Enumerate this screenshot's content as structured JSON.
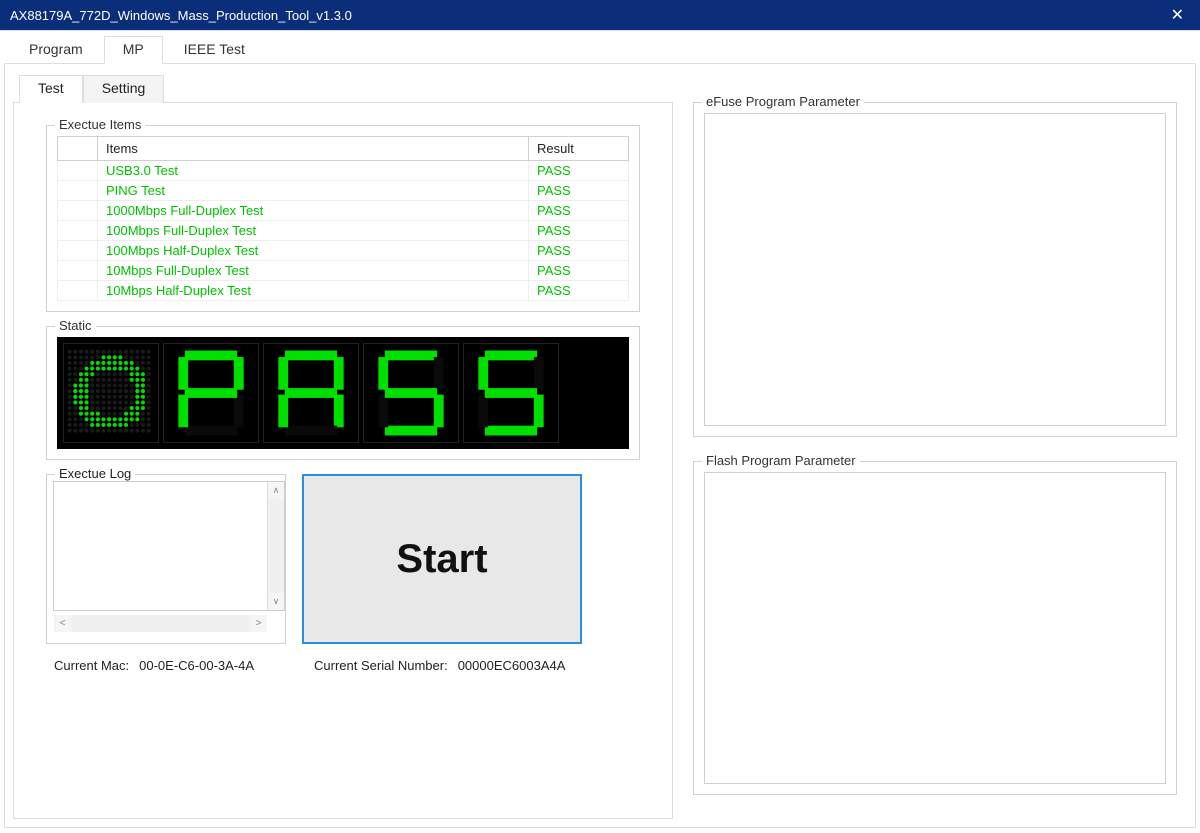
{
  "window": {
    "title": "AX88179A_772D_Windows_Mass_Production_Tool_v1.3.0"
  },
  "tabs_top": [
    "Program",
    "MP",
    "IEEE Test"
  ],
  "tabs_top_active": 1,
  "tabs_inner": [
    "Test",
    "Setting"
  ],
  "tabs_inner_active": 0,
  "group_labels": {
    "exec_items": "Exectue Items",
    "static": "Static",
    "exec_log": "Exectue Log",
    "efuse": "eFuse Program Parameter",
    "flash": "Flash Program Parameter"
  },
  "exec_table": {
    "columns": [
      "Items",
      "Result"
    ],
    "rows": [
      {
        "item": "USB3.0 Test",
        "result": "PASS"
      },
      {
        "item": "PING Test",
        "result": "PASS"
      },
      {
        "item": "1000Mbps Full-Duplex Test",
        "result": "PASS"
      },
      {
        "item": "100Mbps Full-Duplex Test",
        "result": "PASS"
      },
      {
        "item": "100Mbps Half-Duplex Test",
        "result": "PASS"
      },
      {
        "item": "10Mbps Full-Duplex Test",
        "result": "PASS"
      },
      {
        "item": "10Mbps Half-Duplex Test",
        "result": "PASS"
      }
    ]
  },
  "static_display": {
    "status": "PASS",
    "letters": [
      "P",
      "A",
      "S",
      "S"
    ]
  },
  "start_button_label": "Start",
  "footer": {
    "mac_label": "Current Mac:",
    "mac_value": "00-0E-C6-00-3A-4A",
    "serial_label": "Current Serial Number:",
    "serial_value": "00000EC6003A4A"
  }
}
